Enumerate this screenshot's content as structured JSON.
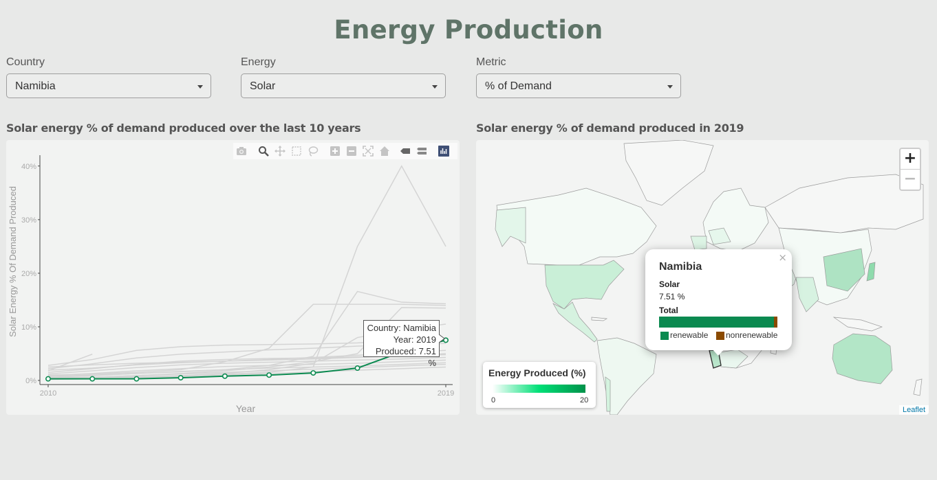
{
  "header": {
    "title": "Energy Production"
  },
  "controls": {
    "country": {
      "label": "Country",
      "value": "Namibia"
    },
    "energy": {
      "label": "Energy",
      "value": "Solar"
    },
    "metric": {
      "label": "Metric",
      "value": "% of Demand"
    }
  },
  "line_panel": {
    "title": "Solar energy % of demand produced over the last 10 years"
  },
  "map_panel": {
    "title": "Solar energy % of demand produced in 2019"
  },
  "modebar": {
    "icons": [
      "camera-icon",
      "zoom-icon",
      "pan-icon",
      "box-select-icon",
      "lasso-select-icon",
      "zoom-in-icon",
      "zoom-out-icon",
      "autoscale-icon",
      "reset-axes-icon",
      "hover-closest-icon",
      "hover-compare-icon",
      "plotly-logo-icon"
    ]
  },
  "chart_data": {
    "type": "line",
    "title": "",
    "xlabel": "Year",
    "ylabel": "Solar Energy % Of Demand Produced",
    "x_ticks": [
      "2010",
      "2019"
    ],
    "y_ticks": [
      "0%",
      "10%",
      "20%",
      "30%",
      "40%"
    ],
    "xlim": [
      2010,
      2019
    ],
    "ylim": [
      0,
      41
    ],
    "grid": false,
    "highlight_series": {
      "name": "Namibia",
      "color": "#0b8a50",
      "x": [
        2010,
        2011,
        2012,
        2013,
        2014,
        2015,
        2016,
        2017,
        2018,
        2019
      ],
      "y": [
        0.3,
        0.3,
        0.3,
        0.5,
        0.8,
        1.0,
        1.4,
        2.3,
        5.3,
        7.51
      ]
    },
    "background_series_color": "#d4d4d4",
    "background_series": [
      {
        "x": [
          2010,
          2011,
          2012,
          2013,
          2014,
          2015,
          2016,
          2017,
          2018,
          2019
        ],
        "y": [
          0.5,
          0.6,
          0.7,
          0.9,
          1.2,
          1.5,
          2.5,
          25.0,
          40.0,
          25.0
        ]
      },
      {
        "x": [
          2010,
          2011,
          2012,
          2013,
          2014,
          2015,
          2016,
          2017,
          2018,
          2019
        ],
        "y": [
          1.0,
          1.2,
          1.5,
          2.0,
          3.5,
          6.0,
          14.2,
          14.2,
          14.2,
          14.0
        ]
      },
      {
        "x": [
          2010,
          2011,
          2012,
          2013,
          2014,
          2015,
          2016,
          2017,
          2018,
          2019
        ],
        "y": [
          0.8,
          1.0,
          1.3,
          1.6,
          2.0,
          2.8,
          4.5,
          16.6,
          14.6,
          14.3
        ]
      },
      {
        "x": [
          2010,
          2011,
          2012,
          2013,
          2014,
          2015,
          2016,
          2017,
          2018,
          2019
        ],
        "y": [
          0.4,
          0.6,
          0.9,
          1.3,
          1.8,
          2.5,
          3.5,
          5.0,
          13.6,
          13.5
        ]
      },
      {
        "x": [
          2010,
          2011,
          2012,
          2013,
          2014,
          2015,
          2016,
          2017,
          2018,
          2019
        ],
        "y": [
          0.3,
          0.4,
          0.6,
          0.9,
          1.3,
          2.0,
          3.2,
          8.0,
          9.5,
          10.5
        ]
      },
      {
        "x": [
          2010,
          2011,
          2012,
          2013,
          2014,
          2015,
          2016,
          2017,
          2018,
          2019
        ],
        "y": [
          2.8,
          3.9,
          5.6,
          6.3,
          6.6,
          6.7,
          6.8,
          7.0,
          7.5,
          7.8
        ]
      },
      {
        "x": [
          2010,
          2011,
          2012,
          2013,
          2014,
          2015,
          2016,
          2017,
          2018,
          2019
        ],
        "y": [
          2.2,
          3.1,
          4.2,
          4.9,
          5.3,
          5.7,
          6.0,
          6.4,
          6.6,
          6.9
        ]
      },
      {
        "x": [
          2010,
          2011,
          2012,
          2013,
          2014,
          2015,
          2016,
          2017,
          2018,
          2019
        ],
        "y": [
          1.5,
          2.2,
          3.0,
          3.6,
          3.9,
          4.1,
          4.2,
          4.4,
          4.6,
          4.8
        ]
      },
      {
        "x": [
          2010,
          2011,
          2012,
          2013,
          2014,
          2015,
          2016,
          2017,
          2018,
          2019
        ],
        "y": [
          1.2,
          1.8,
          2.4,
          2.9,
          3.2,
          3.4,
          3.6,
          3.8,
          4.0,
          4.3
        ]
      },
      {
        "x": [
          2010,
          2011,
          2012,
          2013,
          2014,
          2015,
          2016,
          2017,
          2018,
          2019
        ],
        "y": [
          0.9,
          1.3,
          1.8,
          2.2,
          2.6,
          2.8,
          3.0,
          3.2,
          3.5,
          3.8
        ]
      },
      {
        "x": [
          2010,
          2011,
          2012,
          2013,
          2014,
          2015,
          2016,
          2017,
          2018,
          2019
        ],
        "y": [
          0.6,
          0.9,
          1.3,
          1.7,
          2.0,
          2.3,
          2.5,
          2.7,
          3.0,
          3.3
        ]
      },
      {
        "x": [
          2010,
          2011,
          2012,
          2013,
          2014,
          2015,
          2016,
          2017,
          2018,
          2019
        ],
        "y": [
          0.4,
          0.6,
          0.9,
          1.2,
          1.5,
          1.8,
          2.1,
          2.4,
          2.7,
          3.0
        ]
      },
      {
        "x": [
          2010,
          2011,
          2012,
          2013,
          2014,
          2015,
          2016,
          2017,
          2018,
          2019
        ],
        "y": [
          0.2,
          0.3,
          0.5,
          0.7,
          1.0,
          1.3,
          1.6,
          1.9,
          2.2,
          2.5
        ]
      },
      {
        "x": [
          2010,
          2011
        ],
        "y": [
          1.8,
          4.9
        ]
      },
      {
        "x": [
          2010,
          2011,
          2012,
          2013,
          2014,
          2015,
          2016,
          2017,
          2018,
          2019
        ],
        "y": [
          1.9,
          2.3,
          2.9,
          3.3,
          3.6,
          3.9,
          4.3,
          4.7,
          5.2,
          5.6
        ]
      },
      {
        "x": [
          2010,
          2011,
          2012,
          2013,
          2014,
          2015,
          2016,
          2017,
          2018,
          2019
        ],
        "y": [
          2.5,
          2.9,
          3.2,
          3.4,
          3.6,
          3.8,
          4.0,
          4.3,
          4.6,
          5.0
        ]
      }
    ],
    "tooltip": {
      "country_line": "Country: Namibia",
      "year_line": "Year: 2019",
      "produced_line": "Produced: 7.51 %"
    }
  },
  "map": {
    "zoom_in_label": "+",
    "zoom_out_label": "−",
    "popup": {
      "close": "×",
      "country": "Namibia",
      "energy": "Solar",
      "value": "7.51 %",
      "total_label": "Total",
      "renewable_pct": 97,
      "renewable_label": "renewable",
      "nonrenewable_label": "nonrenewable",
      "renewable_color": "#0b8a50",
      "nonrenewable_color": "#8b4a00"
    },
    "legend": {
      "title": "Energy Produced (%)",
      "min": "0",
      "max": "20"
    },
    "attribution": "Leaflet"
  }
}
